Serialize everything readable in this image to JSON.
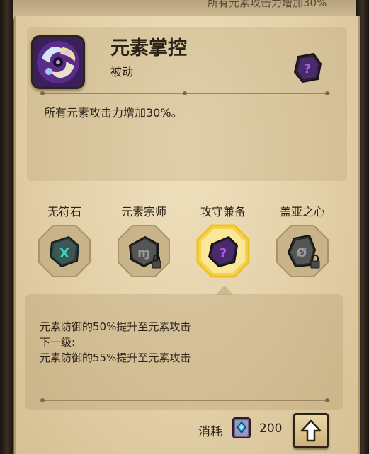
{
  "top_strip": {
    "text": "所有元素攻击力增加30%"
  },
  "skill": {
    "title": "元素掌控",
    "type": "被动",
    "description": "所有元素攻击力增加30%。",
    "icon": "elemental-swirl-icon"
  },
  "corner_rune": {
    "icon": "purple-rune-stone-icon",
    "symbol": "?"
  },
  "runes": [
    {
      "label": "无符石",
      "symbol": "X",
      "color": "#3aa596",
      "locked": false,
      "selected": false,
      "icon": "teal-rune-stone-icon"
    },
    {
      "label": "元素宗师",
      "symbol": "ɱ",
      "color": "#6e6e6e",
      "locked": true,
      "selected": false,
      "icon": "grey-rune-stone-icon"
    },
    {
      "label": "攻守兼备",
      "symbol": "?",
      "color": "#8a37c8",
      "locked": false,
      "selected": true,
      "icon": "purple-rune-stone-icon"
    },
    {
      "label": "盖亚之心",
      "symbol": "Ø",
      "color": "#6e6e6e",
      "locked": true,
      "selected": false,
      "icon": "grey-rune-stone-icon"
    }
  ],
  "detail": {
    "current": "元素防御的50%提升至元素攻击",
    "next_label": "下一级:",
    "next": "元素防御的55%提升至元素攻击"
  },
  "cost": {
    "label": "消耗",
    "value": "200",
    "icon": "blue-gem-book-icon"
  },
  "upgrade_button": {
    "icon": "up-arrow-icon"
  }
}
